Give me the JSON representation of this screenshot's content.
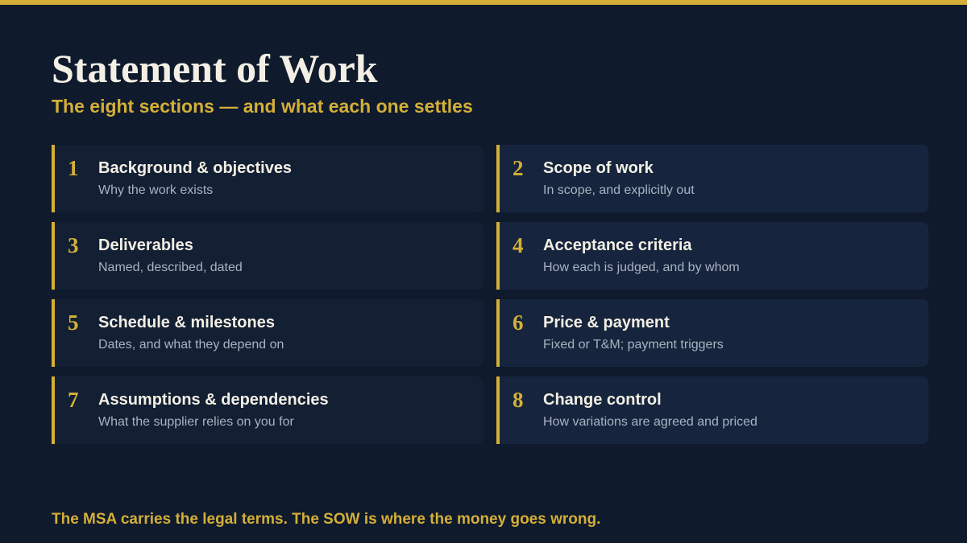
{
  "title": "Statement of Work",
  "subtitle": "The eight sections — and what each one settles",
  "sections": [
    {
      "number": "1",
      "title": "Background & objectives",
      "description": "Why the work exists"
    },
    {
      "number": "2",
      "title": "Scope of work",
      "description": "In scope, and explicitly out"
    },
    {
      "number": "3",
      "title": "Deliverables",
      "description": "Named, described, dated"
    },
    {
      "number": "4",
      "title": "Acceptance criteria",
      "description": "How each is judged, and by whom"
    },
    {
      "number": "5",
      "title": "Schedule & milestones",
      "description": "Dates, and what they depend on"
    },
    {
      "number": "6",
      "title": "Price & payment",
      "description": "Fixed or T&M; payment triggers"
    },
    {
      "number": "7",
      "title": "Assumptions & dependencies",
      "description": "What the supplier relies on you for"
    },
    {
      "number": "8",
      "title": "Change control",
      "description": "How variations are agreed and priced"
    }
  ],
  "footer": "The MSA carries the legal terms. The SOW is where the money goes wrong.",
  "colors": {
    "background": "#0f1a2d",
    "accent": "#d4af37",
    "card_left": "#131f33",
    "card_right": "#16253d",
    "title_text": "#f3efe4",
    "muted_text": "#a9b2c1"
  }
}
